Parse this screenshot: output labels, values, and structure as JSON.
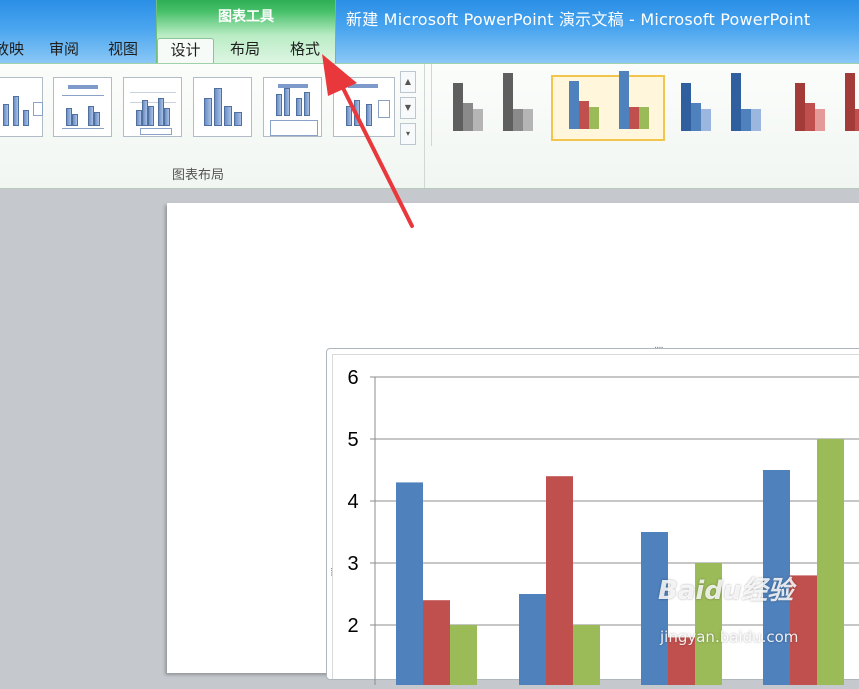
{
  "window": {
    "title": "新建 Microsoft PowerPoint 演示文稿 - Microsoft PowerPoint"
  },
  "context_tab": {
    "label": "图表工具"
  },
  "tabs": [
    {
      "label": "放映",
      "active": false
    },
    {
      "label": "审阅",
      "active": false
    },
    {
      "label": "视图",
      "active": false
    },
    {
      "label": "设计",
      "active": true
    },
    {
      "label": "布局",
      "active": false
    },
    {
      "label": "格式",
      "active": false
    }
  ],
  "ribbon": {
    "layout_group_label": "图表布局",
    "layout_thumbnail_count": 6,
    "style_thumbnails": [
      {
        "colors": [
          "#5f5f5f",
          "#8a8a8a",
          "#b5b5b5"
        ],
        "selected": false
      },
      {
        "colors": [
          "#4f81bd",
          "#c0504d",
          "#9bbb59"
        ],
        "selected": true
      },
      {
        "colors": [
          "#2f5f9e",
          "#4f81bd",
          "#9bb7e0"
        ],
        "selected": false
      },
      {
        "colors": [
          "#a33b38",
          "#c0504d",
          "#e39a98"
        ],
        "selected": false
      }
    ]
  },
  "annotation": {
    "arrow_color": "#e8383b"
  },
  "watermark": {
    "logo": "Baidu经验",
    "url": "jingyan.baidu.com"
  },
  "chart_data": {
    "type": "bar",
    "categories": [
      "",
      "",
      "",
      ""
    ],
    "series": [
      {
        "values": [
          4.3,
          2.5,
          3.5,
          4.5
        ],
        "color": "#4f81bd"
      },
      {
        "values": [
          2.4,
          4.4,
          1.8,
          2.8
        ],
        "color": "#c0504d"
      },
      {
        "values": [
          2.0,
          2.0,
          3.0,
          5.0
        ],
        "color": "#9bbb59"
      }
    ],
    "ylim": [
      0,
      6
    ],
    "visible_y_ticks": [
      "6",
      "5",
      "4",
      "3",
      "2"
    ],
    "grid": true
  }
}
